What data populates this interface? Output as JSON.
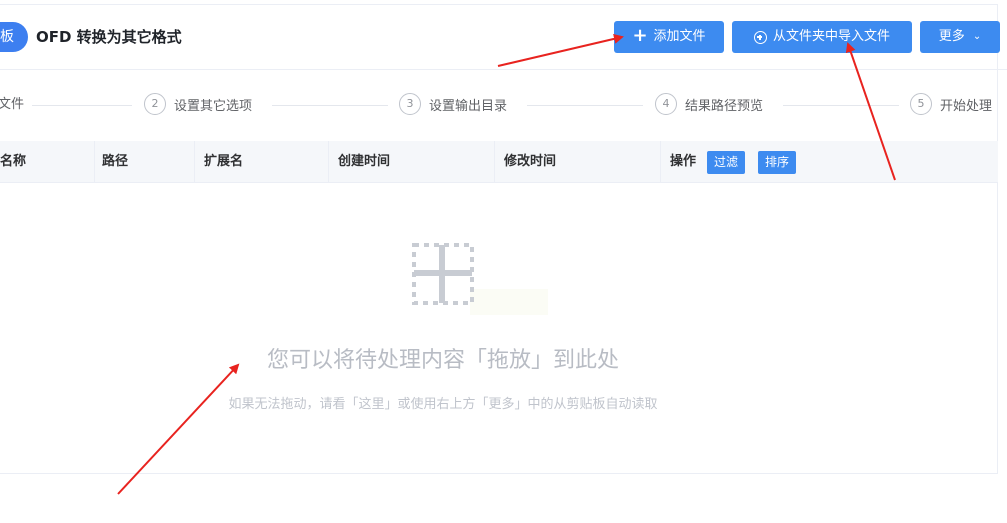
{
  "header": {
    "back_label": "板",
    "title": "OFD 转换为其它格式",
    "add_file_label": "添加文件",
    "import_folder_label": "从文件夹中导入文件",
    "more_label": "更多"
  },
  "steps": [
    {
      "num": "",
      "label": "文件"
    },
    {
      "num": "2",
      "label": "设置其它选项"
    },
    {
      "num": "3",
      "label": "设置输出目录"
    },
    {
      "num": "4",
      "label": "结果路径预览"
    },
    {
      "num": "5",
      "label": "开始处理"
    }
  ],
  "table": {
    "columns": [
      "名称",
      "路径",
      "扩展名",
      "创建时间",
      "修改时间",
      "操作"
    ],
    "filter_label": "过滤",
    "sort_label": "排序"
  },
  "dropzone": {
    "main_text": "您可以将待处理内容「拖放」到此处",
    "sub_text": "如果无法拖动，请看「这里」或使用右上方「更多」中的从剪贴板自动读取"
  },
  "colors": {
    "primary": "#3d8bf0",
    "annotation_arrow": "#e8231f"
  },
  "icons": {
    "add": "plus-icon",
    "import": "circle-plus-icon",
    "more": "chevron-down-icon",
    "drop": "drop-target-icon"
  }
}
